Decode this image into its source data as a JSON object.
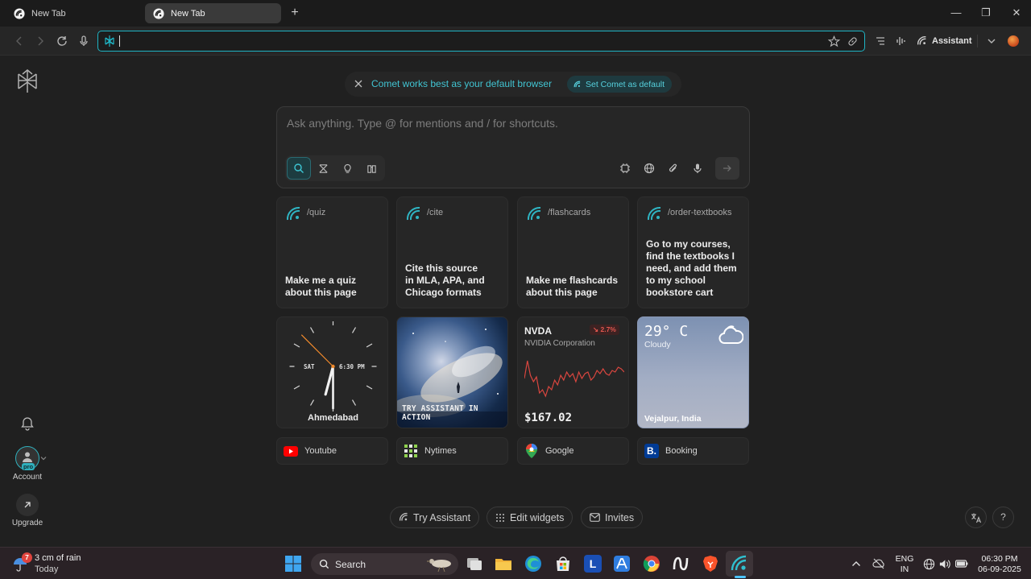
{
  "tabs": [
    {
      "label": "New Tab",
      "active": false
    },
    {
      "label": "New Tab",
      "active": true
    }
  ],
  "window_controls": {
    "new_tab": "+",
    "minimize": "—",
    "maximize": "❐",
    "close": "✕"
  },
  "toolbar": {
    "omnibox_value": "",
    "assistant_label": "Assistant"
  },
  "rail": {
    "account_label": "Account",
    "pro_badge": "pro",
    "upgrade_label": "Upgrade"
  },
  "banner": {
    "message": "Comet works best as your default browser",
    "action": "Set Comet as default"
  },
  "ask": {
    "placeholder": "Ask anything. Type @ for mentions and / for shortcuts."
  },
  "shortcut_cards": [
    {
      "command": "/quiz",
      "description": "Make me a quiz about this page"
    },
    {
      "command": "/cite",
      "description": "Cite this source in MLA, APA, and Chicago formats"
    },
    {
      "command": "/flashcards",
      "description": "Make me flashcards about this page"
    },
    {
      "command": "/order-textbooks",
      "description": "Go to my courses, find the textbooks I need, and add them to my school bookstore cart"
    }
  ],
  "clock": {
    "day": "SAT",
    "time": "6:30 PM",
    "city": "Ahmedabad"
  },
  "assistant_card": {
    "label": "TRY ASSISTANT IN ACTION"
  },
  "stock": {
    "ticker": "NVDA",
    "company": "NVIDIA Corporation",
    "change": "↘ 2.7%",
    "price": "$167.02",
    "line_color": "#d9463f"
  },
  "weather": {
    "temp": "29° C",
    "condition": "Cloudy",
    "location": "Vejalpur, India"
  },
  "links": [
    {
      "label": "Youtube",
      "icon": "youtube-icon"
    },
    {
      "label": "Nytimes",
      "icon": "nytimes-icon"
    },
    {
      "label": "Google",
      "icon": "google-maps-icon"
    },
    {
      "label": "Booking",
      "icon": "booking-icon"
    }
  ],
  "bottom": {
    "try_assistant": "Try Assistant",
    "edit_widgets": "Edit widgets",
    "invites": "Invites"
  },
  "taskbar": {
    "weather_badge": "7",
    "weather_line1": "3 cm of rain",
    "weather_line2": "Today",
    "search_label": "Search",
    "lang_line1": "ENG",
    "lang_line2": "IN",
    "time": "06:30 PM",
    "date": "06-09-2025"
  },
  "colors": {
    "accent": "#1fb4c4",
    "background": "#202020"
  }
}
